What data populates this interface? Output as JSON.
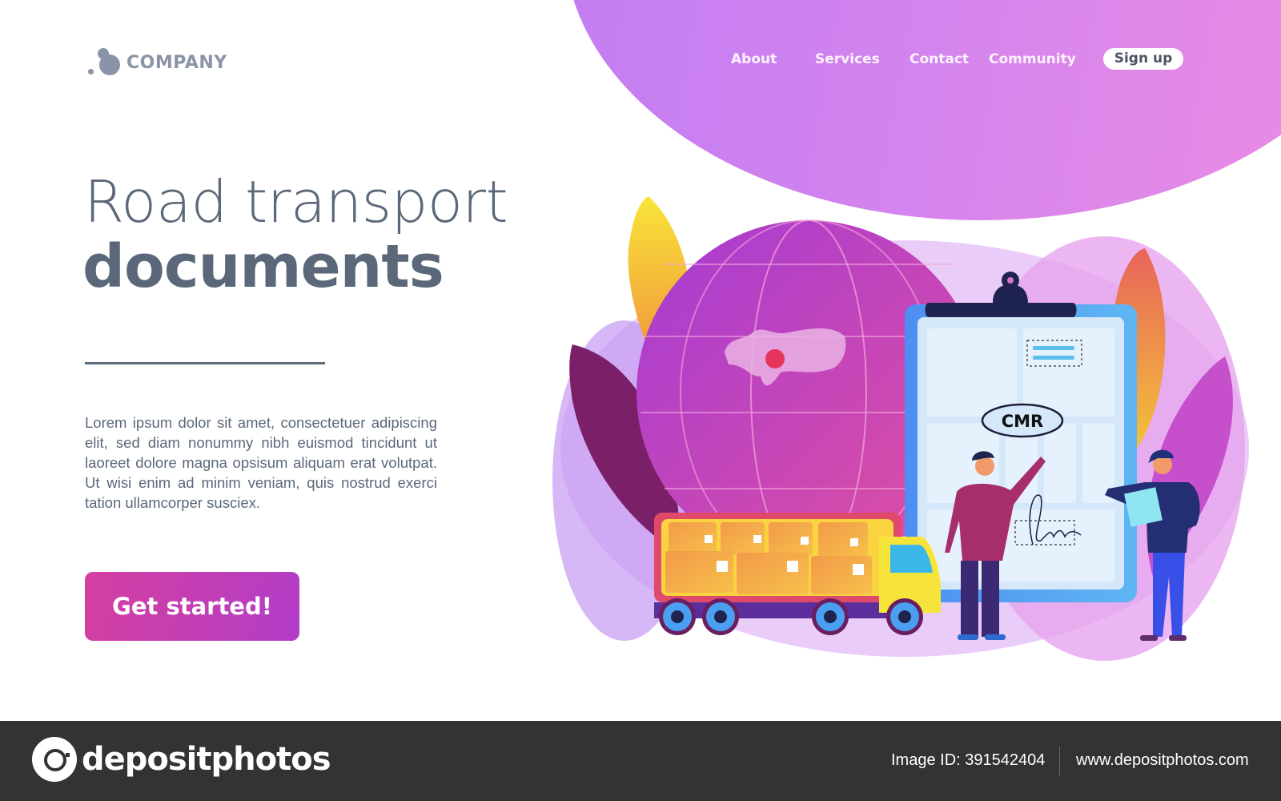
{
  "brand": {
    "logo_text": "COMPANY",
    "logo_color": "#8a93a8"
  },
  "nav": {
    "items": [
      {
        "label": "About"
      },
      {
        "label": "Services"
      },
      {
        "label": "Contact"
      },
      {
        "label": "Community"
      }
    ],
    "signup_label": "Sign up"
  },
  "hero": {
    "title_light": "Road transport",
    "title_bold": "documents",
    "paragraph": "Lorem ipsum dolor sit amet, consectetuer adipiscing elit, sed diam nonummy nibh euismod tincidunt ut laoreet dolore magna opsisum aliquam erat volutpat. Ut wisi enim ad minim veniam, quis nostrud exerci tation ullamcorper susciex.",
    "cta_label": "Get started!",
    "text_color": "#5b6879",
    "accent_gradient": [
      "#d43fa0",
      "#b23dc7"
    ]
  },
  "illustration": {
    "document_label": "CMR",
    "icons": [
      "globe-icon",
      "clipboard-icon",
      "truck-icon",
      "person-icon",
      "courier-icon",
      "leaf-icon",
      "signature-icon"
    ]
  },
  "footer": {
    "brand": "depositphotos",
    "image_id_label": "Image ID: 391542404",
    "website": "www.depositphotos.com"
  }
}
